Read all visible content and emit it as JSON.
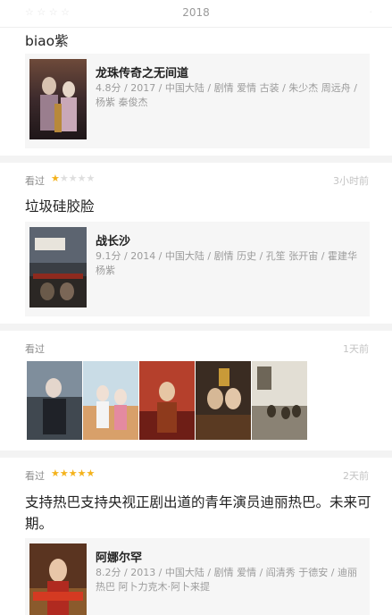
{
  "header": {
    "year": "2018"
  },
  "items": [
    {
      "comment": "biao紫",
      "movie": {
        "title": "龙珠传奇之无间道",
        "info": "4.8分 / 2017 / 中国大陆 / 剧情 爱情 古装 / 朱少杰 周远舟 / 杨紫 秦俊杰"
      }
    },
    {
      "status": "看过",
      "rating": 1,
      "time": "3小时前",
      "comment": "垃圾硅胶脸",
      "movie": {
        "title": "战长沙",
        "info": "9.1分 / 2014 / 中国大陆 / 剧情 历史 / 孔笙 张开宙 / 霍建华 杨紫"
      }
    },
    {
      "status": "看过",
      "time": "1天前",
      "poster_count": 5
    },
    {
      "status": "看过",
      "rating": 5,
      "time": "2天前",
      "comment": "支持热巴支持央视正剧出道的青年演员迪丽热巴。未来可期。",
      "movie": {
        "title": "阿娜尔罕",
        "info": "8.2分 / 2013 / 中国大陆 / 剧情 爱情 / 阎清秀 于德安 / 迪丽热巴 阿卜力克木·阿卜来提"
      }
    }
  ],
  "colors": {
    "star_on": "#f4b21b",
    "star_off": "#dedede",
    "card_bg": "#f6f6f6",
    "separator": "#f3f3f3"
  }
}
